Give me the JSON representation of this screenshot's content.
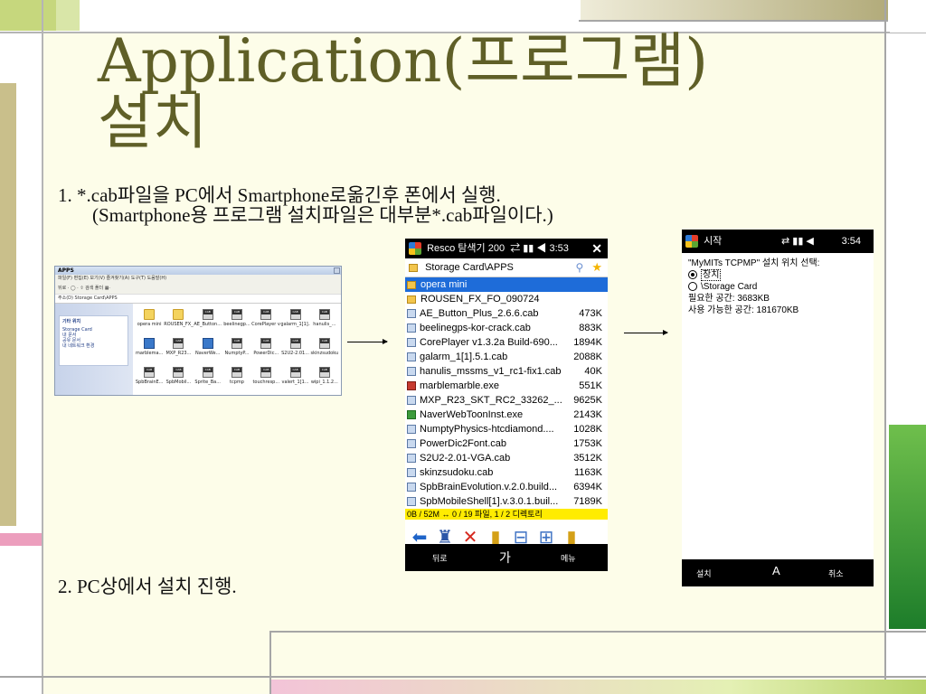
{
  "slide": {
    "title_line1": "Application(프로그램)",
    "title_line2": "설치",
    "step1_line1": "1. *.cab파일을 PC에서 Smartphone로옮긴후 폰에서 실행.",
    "step1_line2": "(Smartphone용 프로그램 설치파일은 대부분*.cab파일이다.)",
    "step2": "2. PC상에서 설치 진행."
  },
  "explorer": {
    "title": "APPS",
    "menu": "파일(F)  편집(E)  보기(V)  즐겨찾기(A)  도구(T)  도움말(H)",
    "toolbar": "뒤로 ·  ◯ ·  ⇧  검색  폴더  ▦·",
    "address": "주소(D)  Storage Card\\APPS",
    "side_header": "기타 위치",
    "side_items": [
      "Storage Card",
      "내 문서",
      "공유 문서",
      "내 네트워크 환경"
    ],
    "files": [
      {
        "name": "opera mini",
        "icon": "folder"
      },
      {
        "name": "ROUSEN_FX_FO_090724",
        "icon": "folder"
      },
      {
        "name": "AE_Button...",
        "icon": "cab"
      },
      {
        "name": "beelinegp...",
        "icon": "cab"
      },
      {
        "name": "CorePlayer v1.3.2a B...",
        "icon": "cab"
      },
      {
        "name": "galarm_1[1]...",
        "icon": "cab"
      },
      {
        "name": "hanulis_...",
        "icon": "cab"
      },
      {
        "name": "marblema...",
        "icon": "exe"
      },
      {
        "name": "MXP_R23...",
        "icon": "cab"
      },
      {
        "name": "NaverWe...",
        "icon": "exe"
      },
      {
        "name": "NumptyP...",
        "icon": "cab"
      },
      {
        "name": "PowerDic...",
        "icon": "cab"
      },
      {
        "name": "S2U2-2.01...",
        "icon": "cab"
      },
      {
        "name": "skinzsudoku",
        "icon": "cab"
      },
      {
        "name": "SpbBrainE...",
        "icon": "cab"
      },
      {
        "name": "SpbMobil...",
        "icon": "cab"
      },
      {
        "name": "Sprite_Ba...",
        "icon": "cab"
      },
      {
        "name": "tcpmp",
        "icon": "cab"
      },
      {
        "name": "touchresp...",
        "icon": "cab"
      },
      {
        "name": "valert_1[1...",
        "icon": "cab"
      },
      {
        "name": "wipi_1.1.2...",
        "icon": "cab"
      }
    ]
  },
  "phone1": {
    "status_title": "Resco 탐색기 200",
    "status_time": "3:53",
    "path": "Storage Card\\APPS",
    "rows": [
      {
        "name": "opera mini",
        "size": "",
        "icon": "folder",
        "selected": true
      },
      {
        "name": "ROUSEN_FX_FO_090724",
        "size": "",
        "icon": "folder",
        "selected": false
      },
      {
        "name": "AE_Button_Plus_2.6.6.cab",
        "size": "473K",
        "icon": "cab",
        "selected": false
      },
      {
        "name": "beelinegps-kor-crack.cab",
        "size": "883K",
        "icon": "cab",
        "selected": false
      },
      {
        "name": "CorePlayer v1.3.2a Build-690...",
        "size": "1894K",
        "icon": "cab",
        "selected": false
      },
      {
        "name": "galarm_1[1].5.1.cab",
        "size": "2088K",
        "icon": "cab",
        "selected": false
      },
      {
        "name": "hanulis_mssms_v1_rc1-fix1.cab",
        "size": "40K",
        "icon": "cab",
        "selected": false
      },
      {
        "name": "marblemarble.exe",
        "size": "551K",
        "icon": "exe",
        "selected": false
      },
      {
        "name": "MXP_R23_SKT_RC2_33262_...",
        "size": "9625K",
        "icon": "cab",
        "selected": false
      },
      {
        "name": "NaverWebToonInst.exe",
        "size": "2143K",
        "icon": "exe2",
        "selected": false
      },
      {
        "name": "NumptyPhysics-htcdiamond....",
        "size": "1028K",
        "icon": "cab",
        "selected": false
      },
      {
        "name": "PowerDic2Font.cab",
        "size": "1753K",
        "icon": "cab",
        "selected": false
      },
      {
        "name": "S2U2-2.01-VGA.cab",
        "size": "3512K",
        "icon": "cab",
        "selected": false
      },
      {
        "name": "skinzsudoku.cab",
        "size": "1163K",
        "icon": "cab",
        "selected": false
      },
      {
        "name": "SpbBrainEvolution.v.2.0.build...",
        "size": "6394K",
        "icon": "cab",
        "selected": false
      },
      {
        "name": "SpbMobileShell[1].v.3.0.1.buil...",
        "size": "7189K",
        "icon": "cab",
        "selected": false
      }
    ],
    "info": "0B / 52M ↔ 0 / 19 파일, 1 / 2 디렉토리",
    "softkey_left": "뒤로",
    "softkey_mid": "가",
    "softkey_right": "메뉴"
  },
  "phone2": {
    "status_title": "시작",
    "status_time": "3:54",
    "prompt": "\"MyMITs TCPMP\" 설치 위치 선택:",
    "option1": "장치",
    "option2": "\\Storage Card",
    "required": "필요한 공간: 3683KB",
    "available": "사용 가능한 공간: 181670KB",
    "softkey_left": "설치",
    "softkey_mid": "A",
    "softkey_right": "취소"
  }
}
